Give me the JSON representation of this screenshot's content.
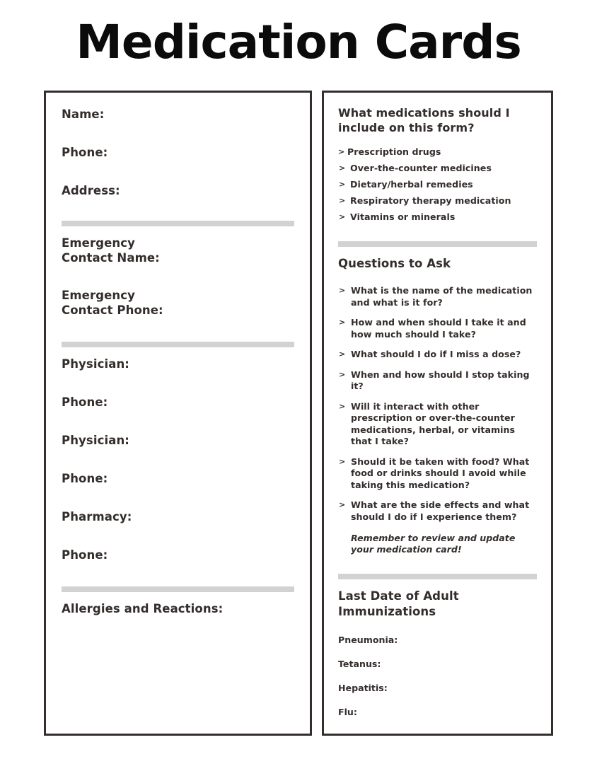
{
  "document": {
    "title": "Medication Cards"
  },
  "colors": {
    "card_border": "#332d2b",
    "divider": "#d2d2d2",
    "text": "#332d2b",
    "title": "#0b0b0b"
  },
  "left_card": {
    "groups": [
      {
        "fields": [
          "Name:",
          "Phone:",
          "Address:"
        ]
      },
      {
        "fields": [
          "Emergency\nContact Name:",
          "Emergency\nContact Phone:"
        ]
      },
      {
        "fields": [
          "Physician:",
          "Phone:",
          "Physician:",
          "Phone:",
          "Pharmacy:",
          "Phone:"
        ]
      },
      {
        "fields": [
          "Allergies and Reactions:"
        ]
      }
    ]
  },
  "right_card": {
    "section_medications": {
      "heading": "What medications should I include on this form?",
      "bullet_mark": ">",
      "items": [
        "Prescription drugs",
        "Over-the-counter medicines",
        "Dietary/herbal remedies",
        "Respiratory therapy medication",
        "Vitamins or minerals"
      ]
    },
    "section_questions": {
      "heading": "Questions to Ask",
      "bullet_mark": ">",
      "items": [
        "What is the name of the medication and what is it for?",
        "How and when should I take it and how much should I take?",
        "What should I do if I miss a dose?",
        "When and how should I stop taking it?",
        "Will it interact with other prescription or over-the-counter medications, herbal, or vitamins that I take?",
        "Should it be taken with food? What food or drinks should I avoid while taking this medication?",
        "What are the side effects and what should I do if I experience them?"
      ],
      "note": "Remember to review and update your medication card!"
    },
    "section_immunizations": {
      "heading": "Last Date of Adult Immunizations",
      "items": [
        "Pneumonia:",
        "Tetanus:",
        "Hepatitis:",
        "Flu:"
      ]
    }
  }
}
